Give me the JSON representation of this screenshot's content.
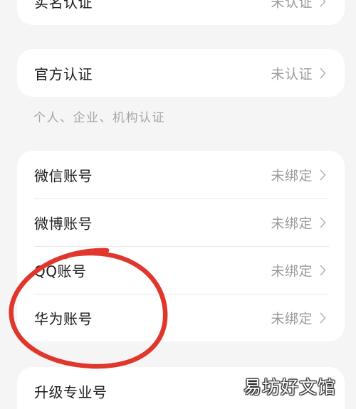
{
  "sections": {
    "real_name": {
      "label": "实名认证",
      "value": "未认证"
    },
    "official": {
      "label": "官方认证",
      "value": "未认证",
      "caption": "个人、企业、机构认证"
    },
    "accounts": [
      {
        "label": "微信账号",
        "value": "未绑定"
      },
      {
        "label": "微博账号",
        "value": "未绑定"
      },
      {
        "label": "QQ账号",
        "value": "未绑定"
      },
      {
        "label": "华为账号",
        "value": "未绑定"
      }
    ],
    "upgrade": {
      "label": "升级专业号"
    }
  },
  "icons": {
    "row_arrow": "chevron-right-icon"
  },
  "annotation": {
    "color": "#e0362b"
  },
  "watermark": {
    "text": "易坊好文馆"
  }
}
